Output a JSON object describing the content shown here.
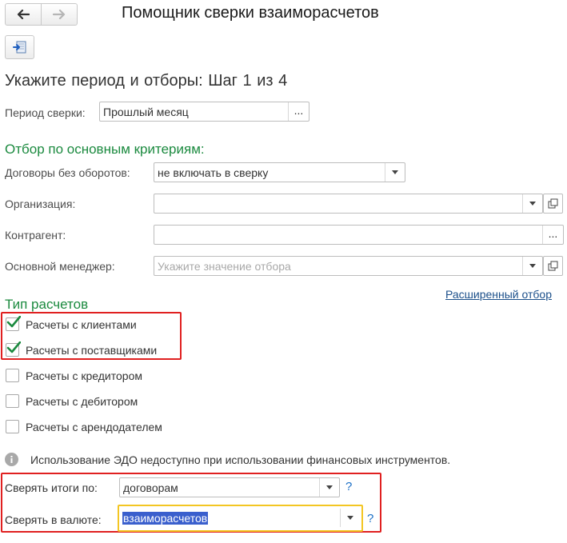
{
  "window": {
    "title": "Помощник сверки взаиморасчетов"
  },
  "nav": {
    "back_icon": "arrow-left-icon",
    "forward_icon": "arrow-right-icon"
  },
  "toolbar": {
    "icon": "document-arrow-icon"
  },
  "step": {
    "title": "Укажите период и отборы:  Шаг 1 из 4"
  },
  "period": {
    "label": "Период сверки:",
    "value": "Прошлый месяц",
    "button": "..."
  },
  "criteria": {
    "heading": "Отбор по основным критериям:",
    "contracts": {
      "label": "Договоры без оборотов:",
      "value": "не включать в сверку"
    },
    "organization": {
      "label": "Организация:",
      "value": ""
    },
    "counterparty": {
      "label": "Контрагент:",
      "value": "",
      "button": "..."
    },
    "manager": {
      "label": "Основной менеджер:",
      "placeholder": "Укажите значение отбора"
    },
    "advanced_link": "Расширенный отбор"
  },
  "settlement_types": {
    "heading": "Тип расчетов",
    "items": [
      {
        "label": "Расчеты с клиентами",
        "checked": true
      },
      {
        "label": "Расчеты с поставщиками",
        "checked": true
      },
      {
        "label": "Расчеты с кредитором",
        "checked": false
      },
      {
        "label": "Расчеты с дебитором",
        "checked": false
      },
      {
        "label": "Расчеты с арендодателем",
        "checked": false
      }
    ]
  },
  "info": {
    "icon": "info-icon",
    "text": "Использование ЭДО недоступно при использовании финансовых инструментов."
  },
  "reconcile": {
    "by": {
      "label": "Сверять итоги по:",
      "value": "договорам",
      "help": "?"
    },
    "currency": {
      "label": "Сверять в валюте:",
      "value": "взаиморасчетов",
      "help": "?"
    }
  },
  "colors": {
    "accent_green": "#1b8a3f",
    "highlight_red": "#e02020",
    "focus_yellow": "#f3c623",
    "link_blue": "#1b4f8a"
  }
}
